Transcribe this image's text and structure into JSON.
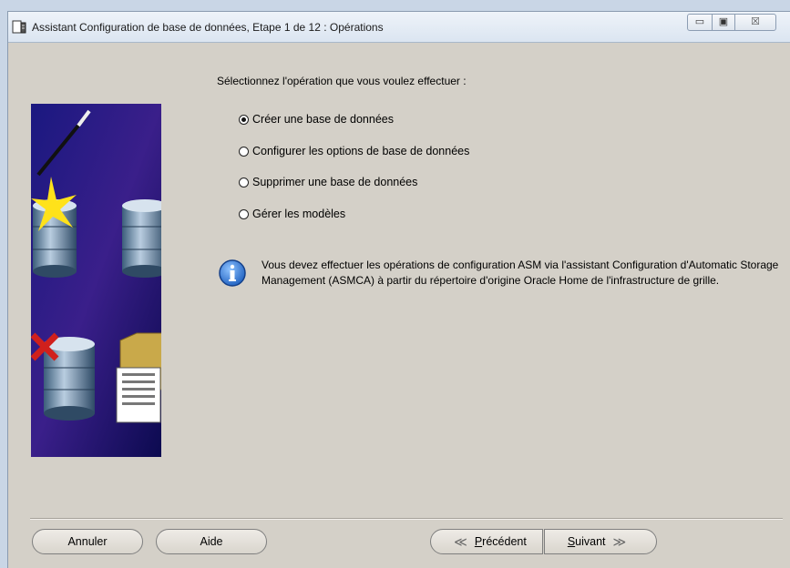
{
  "window": {
    "title": "Assistant Configuration de base de données, Etape 1 de 12 : Opérations",
    "controls": {
      "minimize": "▭",
      "maximize": "▣",
      "close": "☒"
    }
  },
  "main": {
    "prompt": "Sélectionnez l'opération que vous voulez effectuer :",
    "options": [
      {
        "label": "Créer une base de données",
        "selected": true
      },
      {
        "label": "Configurer les options de base de données",
        "selected": false
      },
      {
        "label": "Supprimer une base de données",
        "selected": false
      },
      {
        "label": "Gérer les modèles",
        "selected": false
      }
    ],
    "info": {
      "icon": "info-icon",
      "text": "Vous devez effectuer les opérations de configuration ASM via l'assistant Configuration d'Automatic Storage Management (ASMCA) à partir du répertoire d'origine Oracle Home de l'infrastructure de grille."
    }
  },
  "footer": {
    "cancel": "Annuler",
    "help": "Aide",
    "previous": "Précédent",
    "next": "Suivant",
    "previous_chevron": "≪",
    "next_chevron": "≫"
  },
  "colors": {
    "art_background": "#1b1570",
    "info_blue": "#2a6fd1",
    "check_red": "#d0201c"
  }
}
